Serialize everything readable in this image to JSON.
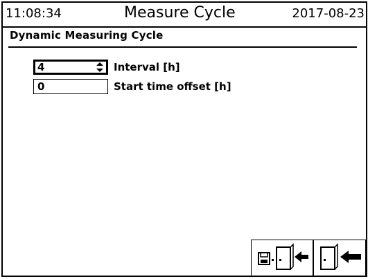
{
  "header": {
    "time": "11:08:34",
    "title": "Measure Cycle",
    "date": "2017-08-23"
  },
  "section": {
    "title": "Dynamic Measuring Cycle"
  },
  "fields": [
    {
      "value": "4",
      "label": "Interval [h]",
      "has_spinner": true,
      "focused": true
    },
    {
      "value": "0",
      "label": "Start time offset [h]",
      "has_spinner": false,
      "focused": false
    }
  ],
  "icons": {
    "spinner": "up-down-arrows-icon",
    "save_exit": "save-and-exit-icon",
    "exit": "exit-door-icon"
  }
}
